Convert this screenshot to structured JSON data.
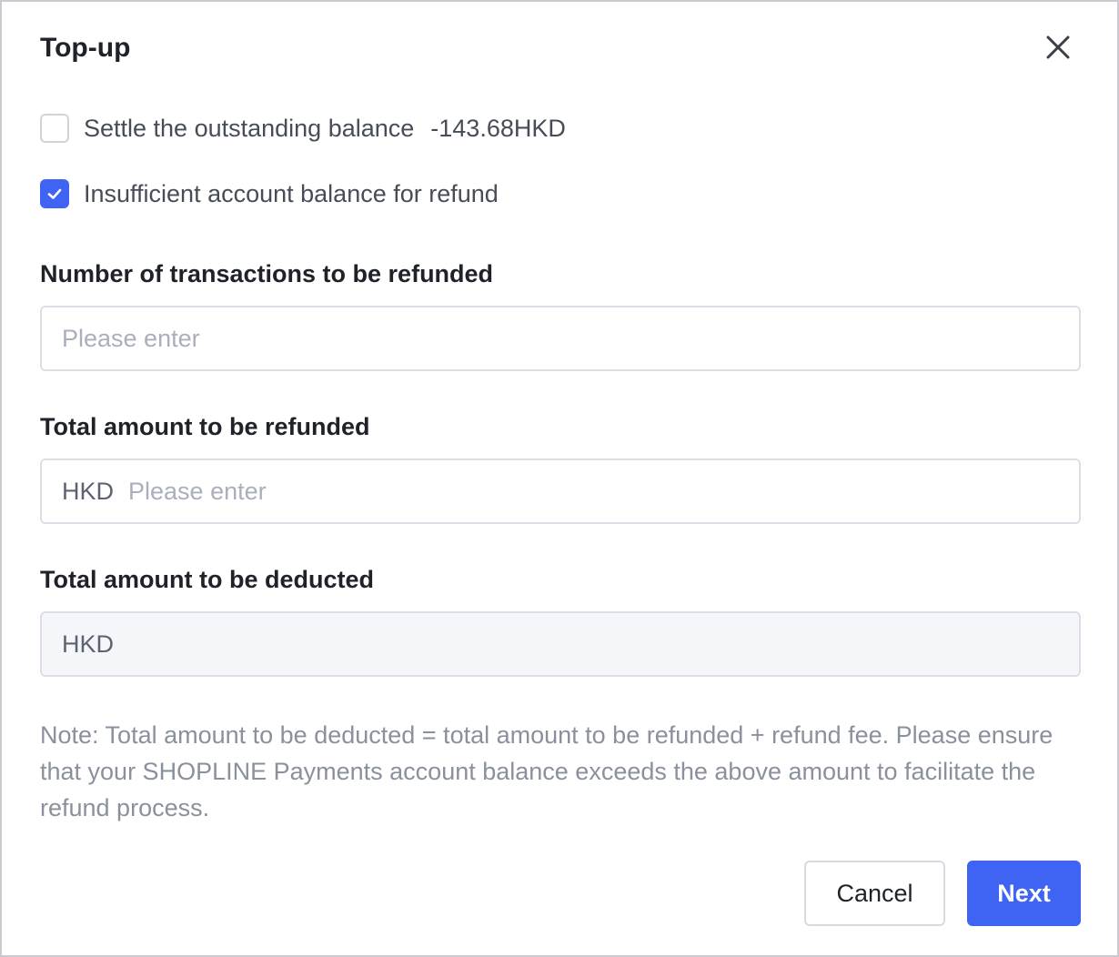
{
  "dialog": {
    "title": "Top-up",
    "close_icon": "close-icon"
  },
  "options": {
    "settle": {
      "label": "Settle the outstanding balance",
      "amount": "-143.68HKD",
      "checked": false
    },
    "insufficient": {
      "label": "Insufficient account balance for refund",
      "checked": true,
      "check_icon": "checkmark-icon"
    }
  },
  "fields": {
    "transactions": {
      "label": "Number of transactions to be refunded",
      "placeholder": "Please enter",
      "value": ""
    },
    "refund_total": {
      "label": "Total amount to be refunded",
      "prefix": "HKD",
      "placeholder": "Please enter",
      "value": ""
    },
    "deducted_total": {
      "label": "Total amount to be deducted",
      "prefix": "HKD",
      "value": ""
    }
  },
  "note": "Note: Total amount to be deducted = total amount to be refunded + refund fee. Please ensure that your SHOPLINE Payments account balance exceeds the above amount to facilitate the refund process.",
  "buttons": {
    "cancel": "Cancel",
    "next": "Next"
  },
  "colors": {
    "primary": "#3f63f3",
    "text": "#1f2329",
    "muted": "#8a909c",
    "border": "#dcdfe6",
    "disabled_bg": "#f5f6fa"
  }
}
